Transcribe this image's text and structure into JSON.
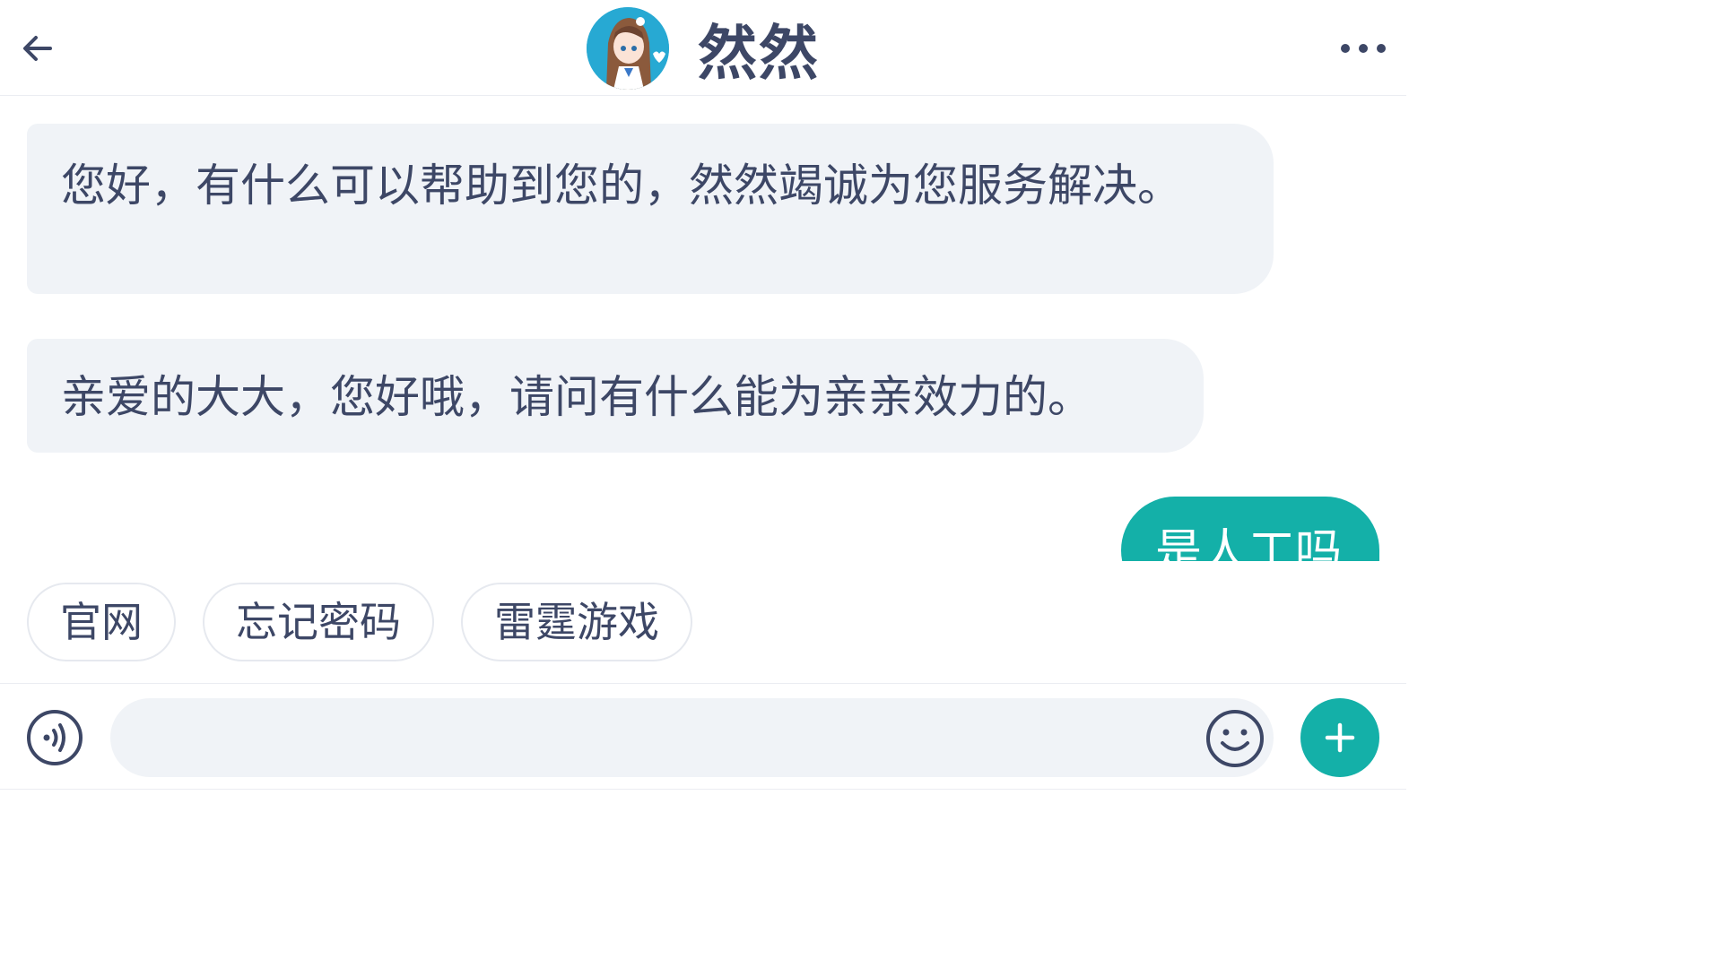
{
  "header": {
    "title": "然然",
    "back_icon": "back-arrow-icon",
    "more_icon": "more-dots-icon"
  },
  "messages": [
    {
      "from": "bot",
      "text": "您好，有什么可以帮助到您的，然然竭诚为您服务解决。"
    },
    {
      "from": "bot",
      "text": "亲爱的大大，您好哦，请问有什么能为亲亲效力的。"
    },
    {
      "from": "user",
      "text": "是人工吗"
    }
  ],
  "quick_replies": [
    "官网",
    "忘记密码",
    "雷霆游戏"
  ],
  "input": {
    "value": "",
    "placeholder": ""
  },
  "colors": {
    "accent": "#14b0a8",
    "text": "#3d4766",
    "bubble_bg": "#f0f3f7"
  }
}
